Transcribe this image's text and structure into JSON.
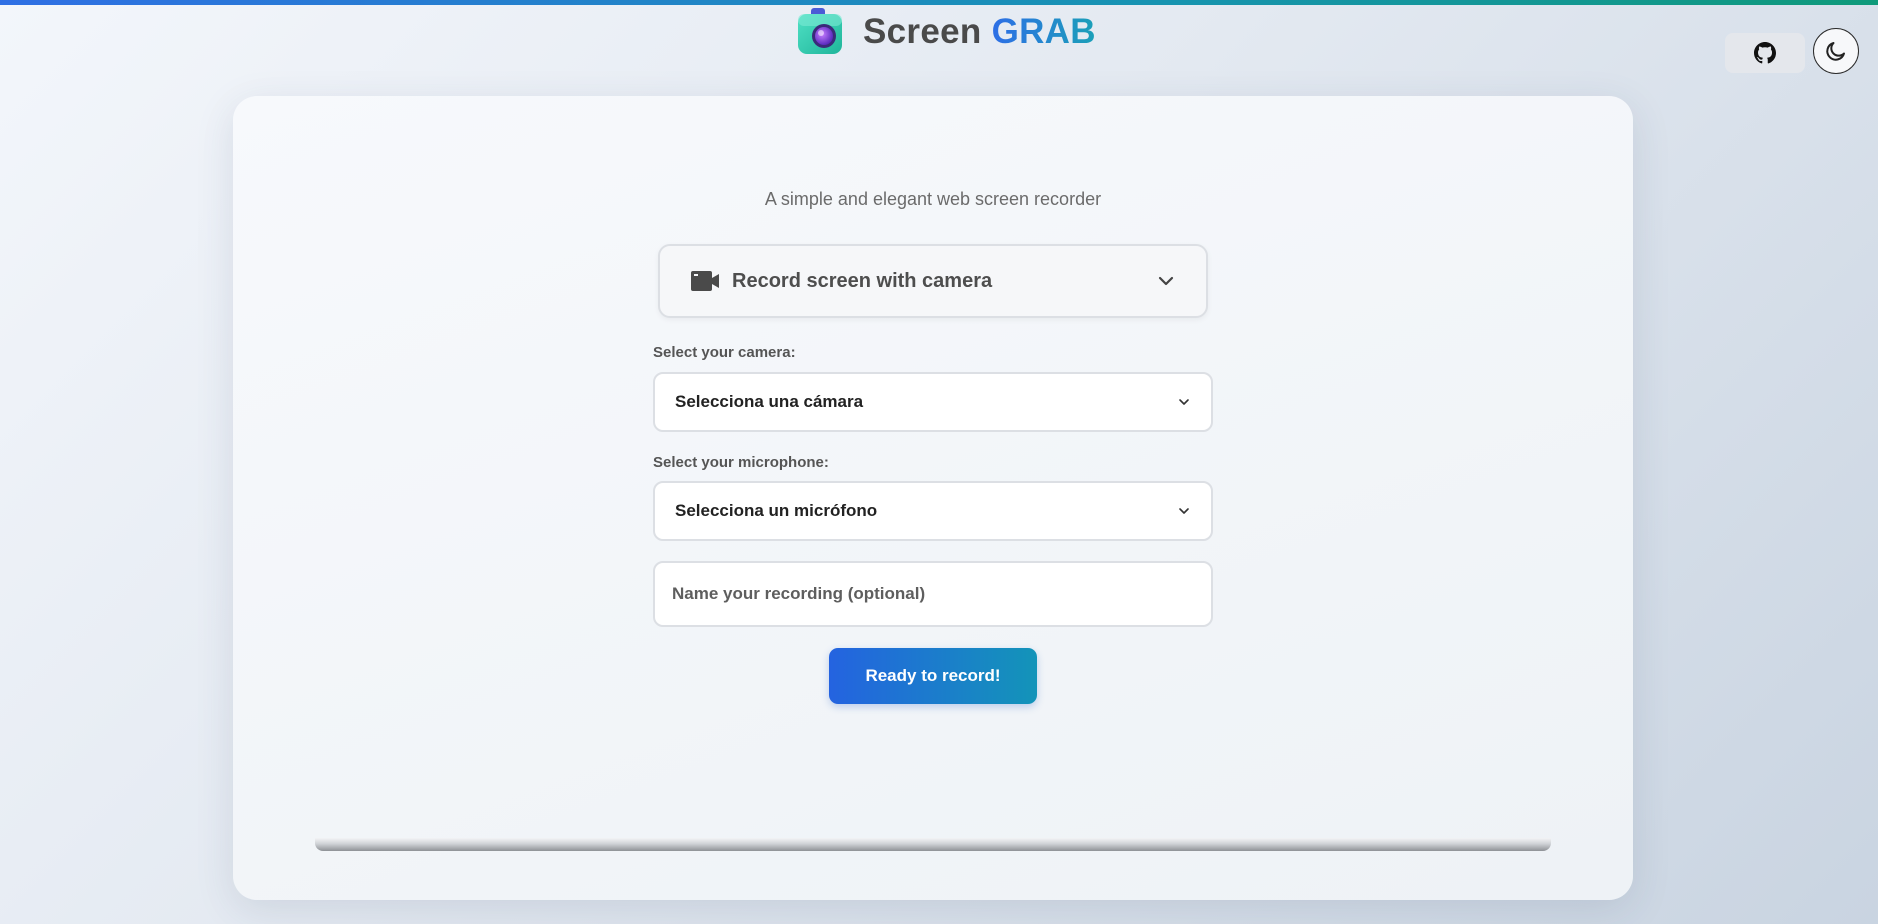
{
  "app": {
    "title_part1": "Screen",
    "title_part2": "GRAB",
    "logo_icon": "camera-logo-icon",
    "accent_gradient": [
      "#2463e0",
      "#1394b9"
    ]
  },
  "header_actions": {
    "github_icon": "github-icon",
    "theme_icon": "moon-icon"
  },
  "main": {
    "subtitle": "A simple and elegant web screen recorder",
    "mode": {
      "icon": "video-camera-icon",
      "selected": "Record screen with camera"
    },
    "camera": {
      "label": "Select your camera:",
      "selected": "Selecciona una cámara"
    },
    "microphone": {
      "label": "Select your microphone:",
      "selected": "Selecciona un micrófono"
    },
    "recording_name": {
      "placeholder": "Name your recording (optional)",
      "value": ""
    },
    "record_button": "Ready to record!",
    "progress": 0
  }
}
